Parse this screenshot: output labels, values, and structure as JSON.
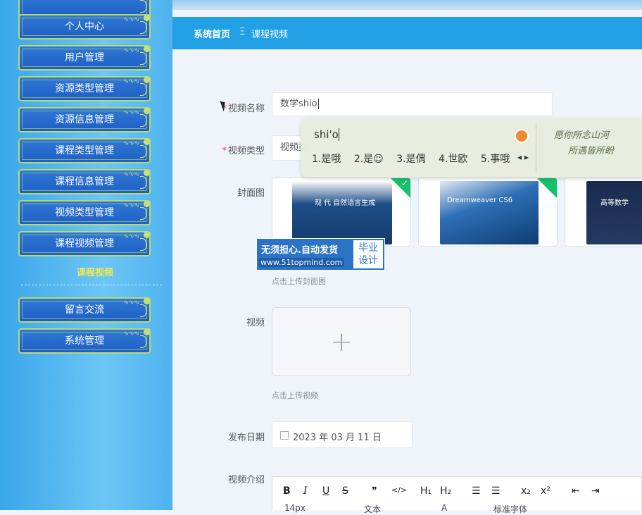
{
  "sidebar": {
    "items": [
      {
        "label": "个人中心"
      },
      {
        "label": "用户管理"
      },
      {
        "label": "资源类型管理"
      },
      {
        "label": "资源信息管理"
      },
      {
        "label": "课程类型管理"
      },
      {
        "label": "课程信息管理"
      },
      {
        "label": "视频类型管理"
      },
      {
        "label": "课程视频管理"
      }
    ],
    "active_sub": "课程视频",
    "bottom_items": [
      {
        "label": "留言交流"
      },
      {
        "label": "系统管理"
      }
    ]
  },
  "breadcrumb": {
    "home": "系统首页",
    "separator": "Ξ",
    "current": "课程视频"
  },
  "form": {
    "video_name_label": "视频名称",
    "video_name_value": "数学shio",
    "video_type_label": "视频类型",
    "video_type_value": "视频类",
    "cover_label": "封面图",
    "cover_hint": "点击上传封面图",
    "video_label": "视频",
    "video_hint": "点击上传视频",
    "date_label": "发布日期",
    "date_value": "2023 年 03 月 11 日",
    "intro_label": "视频介绍",
    "required_mark": "*"
  },
  "covers": [
    {
      "title": "现 代 自然语言生成",
      "selected": true
    },
    {
      "title": "Dreamweaver CS6",
      "selected": true
    },
    {
      "title": "高等数学",
      "selected": false
    }
  ],
  "watermark": {
    "line1": "无须担心.自动发货",
    "line2": "www.51topmind.com",
    "box1": "毕业",
    "box2": "设计"
  },
  "ime": {
    "composition": "shi'o",
    "candidates": [
      "1.是哦",
      "2.是☺",
      "3.是偶",
      "4.世欧",
      "5.事哦"
    ],
    "arrows": "◂ ▸",
    "art_line1": "愿你所念山河",
    "art_line2": "所遇皆所盼"
  },
  "editor": {
    "toolbar1": [
      "B",
      "I",
      "U",
      "S",
      "❞",
      "</>",
      "H₁",
      "H₂",
      "☰",
      "☰",
      "x₂",
      "x²",
      "⇤",
      "⇥"
    ],
    "toolbar2": [
      "14px",
      "文本",
      "A",
      "标准字体"
    ]
  }
}
